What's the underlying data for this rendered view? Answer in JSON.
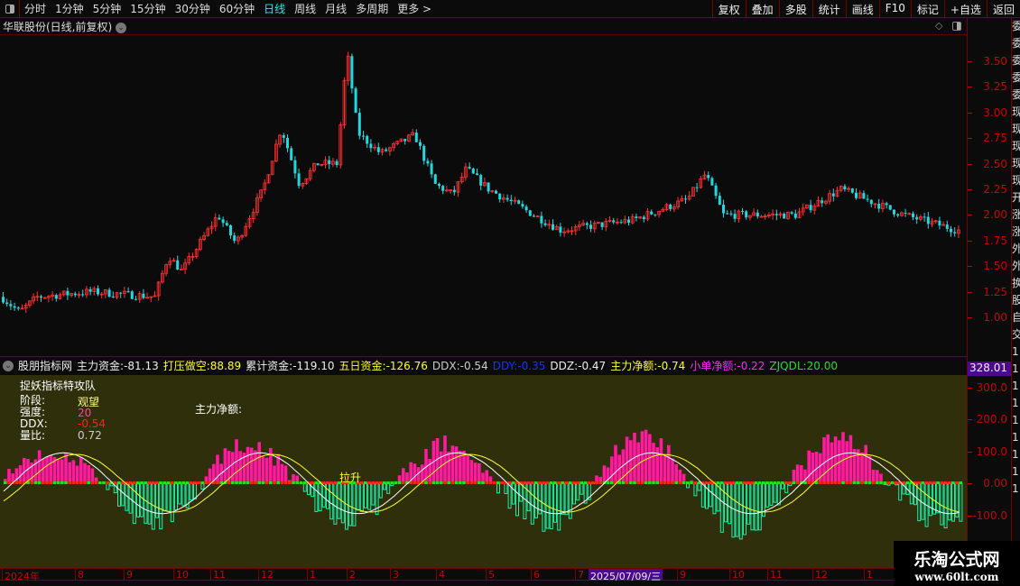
{
  "toolbar": {
    "periods": [
      "分时",
      "1分钟",
      "5分钟",
      "15分钟",
      "30分钟",
      "60分钟",
      "日线",
      "周线",
      "月线",
      "多周期",
      "更多 >"
    ],
    "active": "日线",
    "buttons": [
      "复权",
      "叠加",
      "多股",
      "统计",
      "画线",
      "F10",
      "标记",
      "+自选",
      "返回"
    ]
  },
  "title": "华联股份(日线,前复权)",
  "price_axis": [
    "3.50",
    "3.25",
    "3.00",
    "2.75",
    "2.50",
    "2.25",
    "2.00",
    "1.75",
    "1.50",
    "1.25",
    "1.00"
  ],
  "price_path": [
    [
      0,
      1.2
    ],
    [
      20,
      1.05
    ],
    [
      40,
      1.2
    ],
    [
      100,
      1.25
    ],
    [
      170,
      1.2
    ],
    [
      185,
      1.6
    ],
    [
      200,
      1.45
    ],
    [
      240,
      2.0
    ],
    [
      260,
      1.72
    ],
    [
      290,
      2.25
    ],
    [
      310,
      2.85
    ],
    [
      330,
      2.3
    ],
    [
      350,
      2.5
    ],
    [
      372,
      2.5
    ],
    [
      383,
      3.6
    ],
    [
      395,
      2.8
    ],
    [
      420,
      2.6
    ],
    [
      458,
      2.78
    ],
    [
      480,
      2.3
    ],
    [
      500,
      2.2
    ],
    [
      515,
      2.45
    ],
    [
      540,
      2.25
    ],
    [
      620,
      1.85
    ],
    [
      700,
      1.95
    ],
    [
      760,
      2.15
    ],
    [
      780,
      2.4
    ],
    [
      800,
      2.0
    ],
    [
      880,
      2.0
    ],
    [
      930,
      2.25
    ],
    [
      1000,
      2.0
    ],
    [
      1060,
      1.85
    ]
  ],
  "colors": {
    "up": "#ff3030",
    "down": "#20d8e0",
    "pink": "#ff1aa0",
    "cyan": "#18f0a8",
    "olive": "#2f2f0c"
  },
  "indicator": {
    "name": "股朋指标网",
    "fields": [
      {
        "label": "主力资金:",
        "value": "-81.13",
        "color": "#eeeeee"
      },
      {
        "label": "打压做空:",
        "value": "88.89",
        "color": "#ffff20"
      },
      {
        "label": "累计资金:",
        "value": "-119.10",
        "color": "#eeeeee"
      },
      {
        "label": "五日资金:",
        "value": "-126.76",
        "color": "#ffff20"
      },
      {
        "label": "DDX:",
        "value": "-0.54",
        "color": "#cccccc"
      },
      {
        "label": "DDY:",
        "value": "-0.35",
        "color": "#1a30ff"
      },
      {
        "label": "DDZ:",
        "value": "-0.47",
        "color": "#eeeeee"
      },
      {
        "label": "主力净额:",
        "value": "-0.74",
        "color": "#ffff20"
      },
      {
        "label": "小单净额:",
        "value": "-0.22",
        "color": "#ff20ff"
      },
      {
        "label": "ZJQDL:",
        "value": "20.00",
        "color": "#20e020"
      }
    ],
    "current": "328.01",
    "axis": [
      "300.0",
      "200.0",
      "100.0",
      "0.00",
      "-100.0"
    ],
    "overlay": {
      "heading": "捉妖指标特攻队",
      "stage_label": "阶段:",
      "stage_value": "观望",
      "strength_label": "强度:",
      "strength_value": "20",
      "ddx_label": "DDX:",
      "ddx_value": "-0.54",
      "vol_label": "量比:",
      "vol_value": "0.72",
      "net_label": "主力净额:",
      "signal": "拉升"
    }
  },
  "date_axis": [
    "2024年",
    "8",
    "9",
    "10",
    "11",
    "12",
    "1",
    "2",
    "3",
    "4",
    "5",
    "6",
    "7",
    "9",
    "10",
    "11",
    "12",
    "1"
  ],
  "date_highlight": "2025/07/09/三",
  "side_text": [
    "委",
    "委",
    "委",
    "委",
    "委",
    "现",
    "现",
    "现",
    "现",
    "现",
    "开",
    "涨",
    "涨",
    "外",
    "外",
    "换",
    "股",
    "自",
    "交",
    "1",
    "1",
    "1",
    "1",
    "1",
    "1",
    "1",
    "1",
    "1"
  ],
  "watermark": {
    "name": "乐淘公式网",
    "url": "www.60lt.com"
  }
}
